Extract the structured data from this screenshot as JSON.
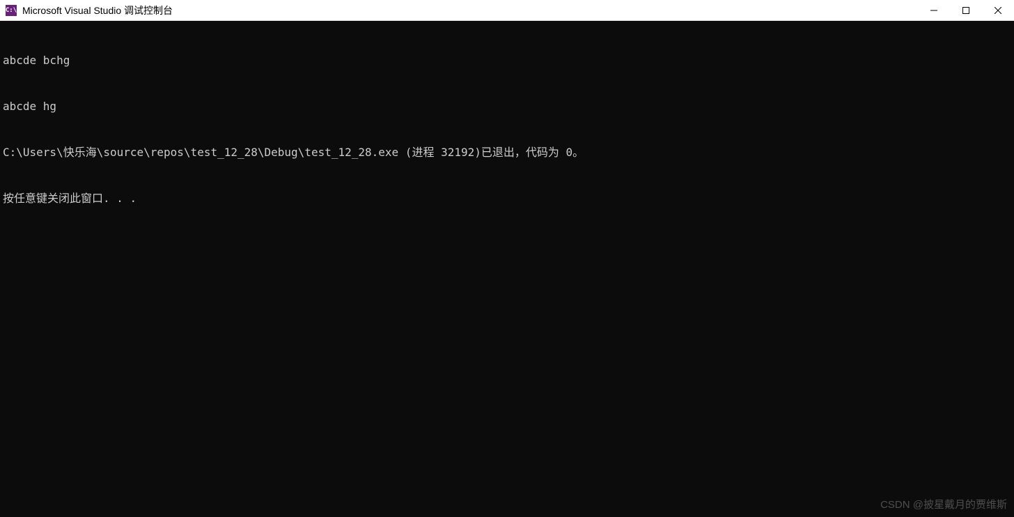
{
  "titlebar": {
    "icon_label": "C:\\",
    "title": "Microsoft Visual Studio 调试控制台"
  },
  "console": {
    "lines": [
      "abcde bchg",
      "abcde hg",
      "C:\\Users\\快乐海\\source\\repos\\test_12_28\\Debug\\test_12_28.exe (进程 32192)已退出，代码为 0。",
      "按任意键关闭此窗口. . ."
    ]
  },
  "watermark": "CSDN @披星戴月的贾维斯"
}
